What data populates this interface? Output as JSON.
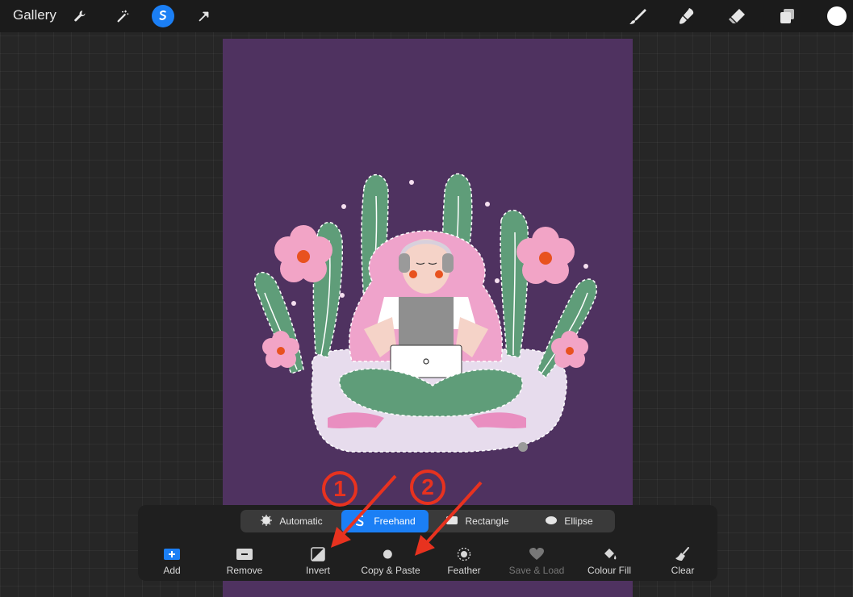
{
  "topbar": {
    "gallery_label": "Gallery",
    "left_icons": [
      "wrench-icon",
      "magic-wand-icon",
      "selection-icon",
      "transform-arrow-icon"
    ],
    "active_icon": "selection-icon",
    "right_icons": [
      "brush-icon",
      "smudge-icon",
      "eraser-icon",
      "layers-icon"
    ],
    "current_color": "#ffffff"
  },
  "selection_modes": {
    "items": [
      {
        "label": "Automatic",
        "icon": "automatic-icon"
      },
      {
        "label": "Freehand",
        "icon": "freehand-icon"
      },
      {
        "label": "Rectangle",
        "icon": "rectangle-icon"
      },
      {
        "label": "Ellipse",
        "icon": "ellipse-icon"
      }
    ],
    "active": "Freehand"
  },
  "tools": {
    "items": [
      {
        "label": "Add",
        "icon": "add-icon",
        "enabled": true
      },
      {
        "label": "Remove",
        "icon": "remove-icon",
        "enabled": true
      },
      {
        "label": "Invert",
        "icon": "invert-icon",
        "enabled": true
      },
      {
        "label": "Copy & Paste",
        "icon": "copy-paste-icon",
        "enabled": true
      },
      {
        "label": "Feather",
        "icon": "feather-icon",
        "enabled": true
      },
      {
        "label": "Save & Load",
        "icon": "heart-icon",
        "enabled": false
      },
      {
        "label": "Colour Fill",
        "icon": "paint-bucket-icon",
        "enabled": true
      },
      {
        "label": "Clear",
        "icon": "broom-icon",
        "enabled": true
      }
    ]
  },
  "annotations": {
    "markers": [
      "1",
      "2"
    ],
    "color": "#e8321f"
  },
  "colors": {
    "accent": "#1b7ff5",
    "canvas": "#4f3260",
    "marker": "#e8321f"
  }
}
